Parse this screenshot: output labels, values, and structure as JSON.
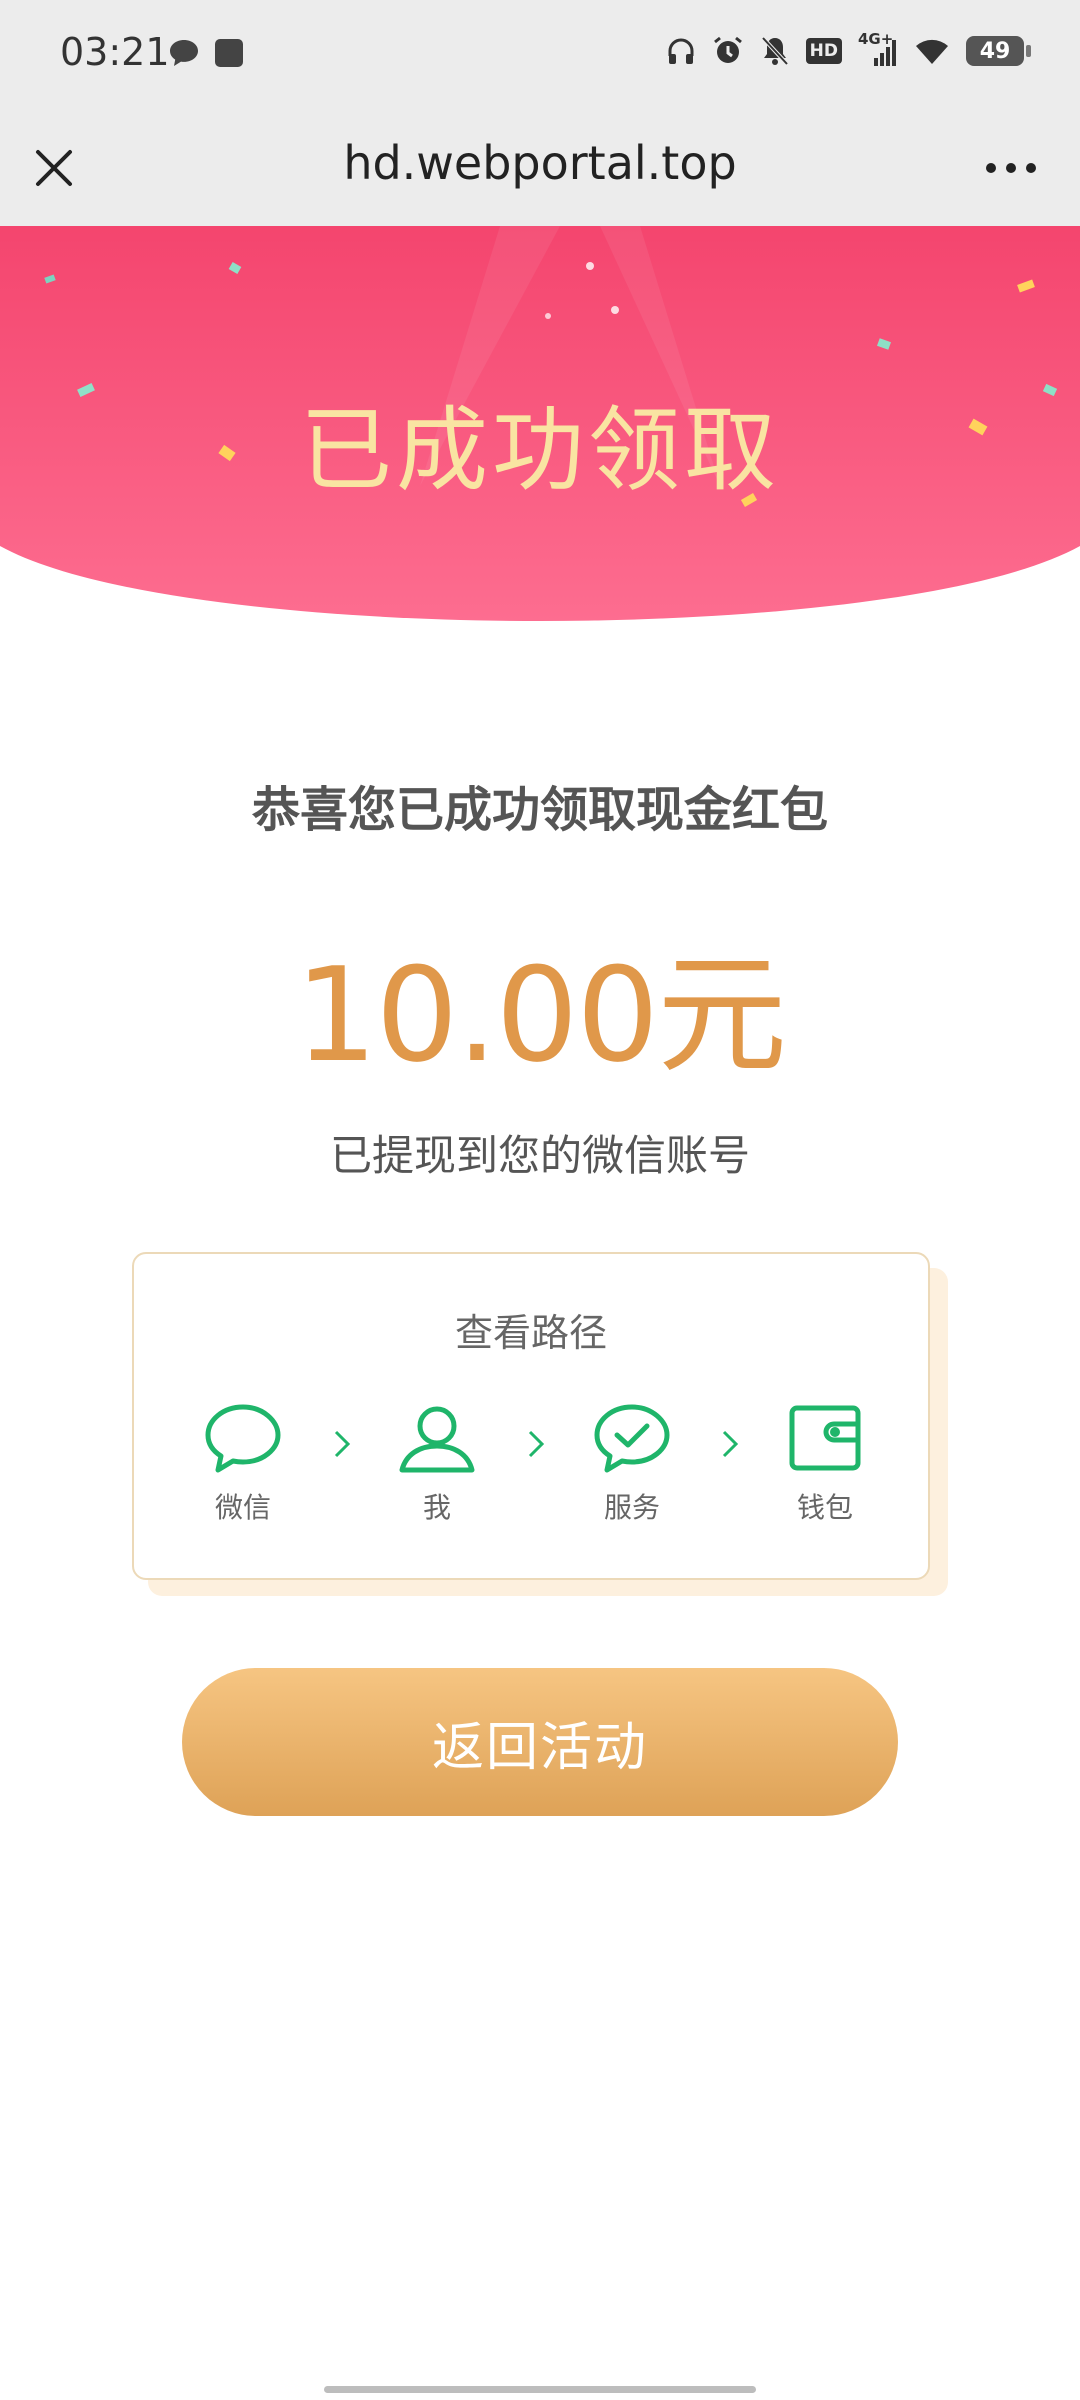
{
  "status_bar": {
    "time": "03:21",
    "network": "4G+",
    "hd_badge": "HD",
    "battery": "49",
    "icons": [
      "message-icon",
      "app-square-icon",
      "headphones-icon",
      "alarm-icon",
      "mute-bell-icon",
      "hd-icon",
      "signal-icon",
      "wifi-icon",
      "battery-icon"
    ]
  },
  "nav": {
    "title": "hd.webportal.top",
    "close_icon": "close-icon",
    "more_icon": "more-icon"
  },
  "banner": {
    "title": "已成功领取",
    "colors": {
      "top": "#f4476f",
      "bottom": "#fd6b8f"
    }
  },
  "content": {
    "subtitle": "恭喜您已成功领取现金红包",
    "amount": "10.00元",
    "note": "已提现到您的微信账号"
  },
  "path_card": {
    "title": "查看路径",
    "steps": [
      {
        "label": "微信",
        "icon": "chat-bubble-icon"
      },
      {
        "label": "我",
        "icon": "person-icon"
      },
      {
        "label": "服务",
        "icon": "check-bubble-icon"
      },
      {
        "label": "钱包",
        "icon": "wallet-icon"
      }
    ],
    "accent": "#1fb56a"
  },
  "button": {
    "label": "返回活动",
    "colors": {
      "top": "#f6c582",
      "bottom": "#dea257"
    }
  }
}
